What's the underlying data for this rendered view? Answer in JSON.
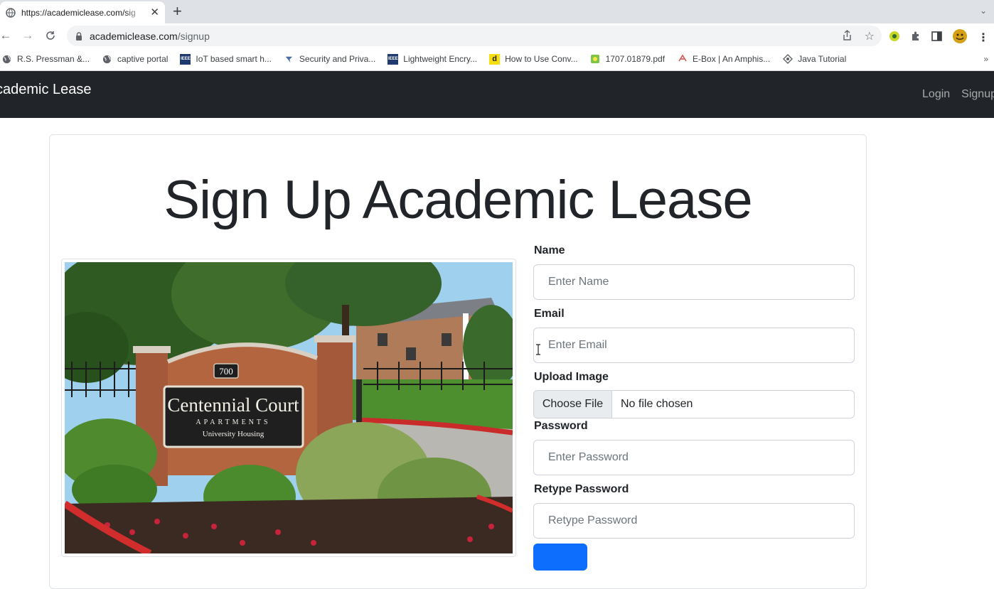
{
  "browser": {
    "tab": {
      "title": "https://academiclease.com/sig"
    },
    "url": {
      "host": "academiclease.com",
      "path": "/signup"
    },
    "bookmarks": [
      {
        "label": "R.S. Pressman &...",
        "icon": "globe-icon"
      },
      {
        "label": "captive portal",
        "icon": "globe-icon"
      },
      {
        "label": "IoT based smart h...",
        "icon": "ieee-icon"
      },
      {
        "label": "Security and Priva...",
        "icon": "leaf-icon"
      },
      {
        "label": "Lightweight Encry...",
        "icon": "ieee-icon"
      },
      {
        "label": "How to Use Conv...",
        "icon": "d-icon"
      },
      {
        "label": "1707.01879.pdf",
        "icon": "pdf-icon"
      },
      {
        "label": "E-Box | An Amphis...",
        "icon": "ebox-icon"
      },
      {
        "label": "Java Tutorial",
        "icon": "java-icon"
      }
    ]
  },
  "navbar": {
    "brand": "cademic Lease",
    "links": {
      "login": "Login",
      "signup": "Signup"
    }
  },
  "page": {
    "title": "Sign Up Academic Lease"
  },
  "form": {
    "name": {
      "label": "Name",
      "placeholder": "Enter Name"
    },
    "email": {
      "label": "Email",
      "placeholder": "Enter Email"
    },
    "image": {
      "label": "Upload Image",
      "button": "Choose File",
      "status": "No file chosen"
    },
    "password": {
      "label": "Password",
      "placeholder": "Enter Password"
    },
    "retype": {
      "label": "Retype Password",
      "placeholder": "Retype Password"
    }
  },
  "photo": {
    "number": "700",
    "sign_main": "Centennial Court",
    "sign_sub": "APARTMENTS",
    "sign_sub2": "University Housing"
  },
  "colors": {
    "navbar_bg": "#212529",
    "primary": "#0d6efd"
  }
}
